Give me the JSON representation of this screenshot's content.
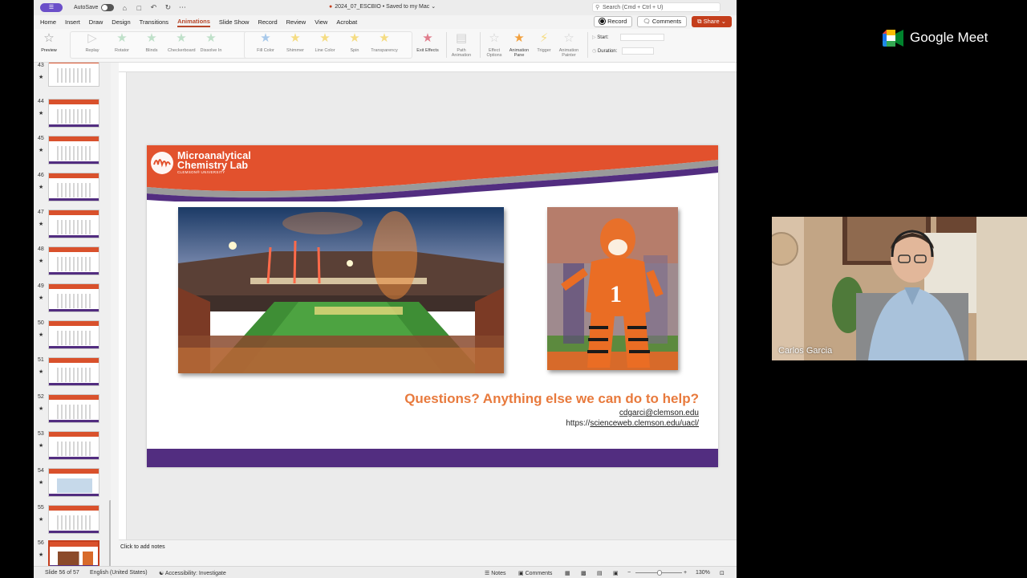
{
  "window": {
    "autosave_label": "AutoSave",
    "doc_title": "2024_07_ESCBIO  •  Saved to my Mac ⌄",
    "search_placeholder": "Search (Cmd + Ctrl + U)"
  },
  "tabs": [
    "Home",
    "Insert",
    "Draw",
    "Design",
    "Transitions",
    "Animations",
    "Slide Show",
    "Record",
    "Review",
    "View",
    "Acrobat"
  ],
  "active_tab": "Animations",
  "toolbar_right": {
    "record": "Record",
    "comments": "Comments",
    "share": "Share"
  },
  "ribbon": {
    "preview": "Preview",
    "effects1": [
      "Replay",
      "Rotator",
      "Blinds",
      "Checkerboard",
      "Dissolve In"
    ],
    "effects2": [
      "Fill Color",
      "Shimmer",
      "Line Color",
      "Spin",
      "Transparency"
    ],
    "exit_effects": "Exit Effects",
    "path_animation": "Path Animation",
    "effect_options": "Effect Options",
    "animation_pane": "Animation Pane",
    "trigger": "Trigger",
    "animation_painter": "Animation Painter",
    "start_label": "Start:",
    "duration_label": "Duration:"
  },
  "thumbnails": [
    {
      "num": "43"
    },
    {
      "num": "44"
    },
    {
      "num": "45"
    },
    {
      "num": "46"
    },
    {
      "num": "47"
    },
    {
      "num": "48"
    },
    {
      "num": "49"
    },
    {
      "num": "50"
    },
    {
      "num": "51"
    },
    {
      "num": "52"
    },
    {
      "num": "53"
    },
    {
      "num": "54"
    },
    {
      "num": "55"
    },
    {
      "num": "56"
    }
  ],
  "selected_thumbnail": "56",
  "slide": {
    "logo_line1": "Microanalytical",
    "logo_line2": "Chemistry Lab",
    "logo_sub": "CLEMSON® UNIVERSITY",
    "question": "Questions? Anything else we can do to help?",
    "email": "cdgarci@clemson.edu",
    "url_prefix": "https://",
    "url_link": "scienceweb.clemson.edu/uacl/",
    "colors": {
      "orange": "#e2512d",
      "purple": "#522d80",
      "question": "#e87a3d"
    }
  },
  "notes_placeholder": "Click to add notes",
  "status": {
    "slide_info": "Slide 56 of 57",
    "language": "English (United States)",
    "accessibility": "Accessibility: Investigate",
    "notes": "Notes",
    "comments": "Comments",
    "zoom": "130%"
  },
  "meet": {
    "brand": "Google Meet",
    "participant_name": "Carlos Garcia"
  }
}
